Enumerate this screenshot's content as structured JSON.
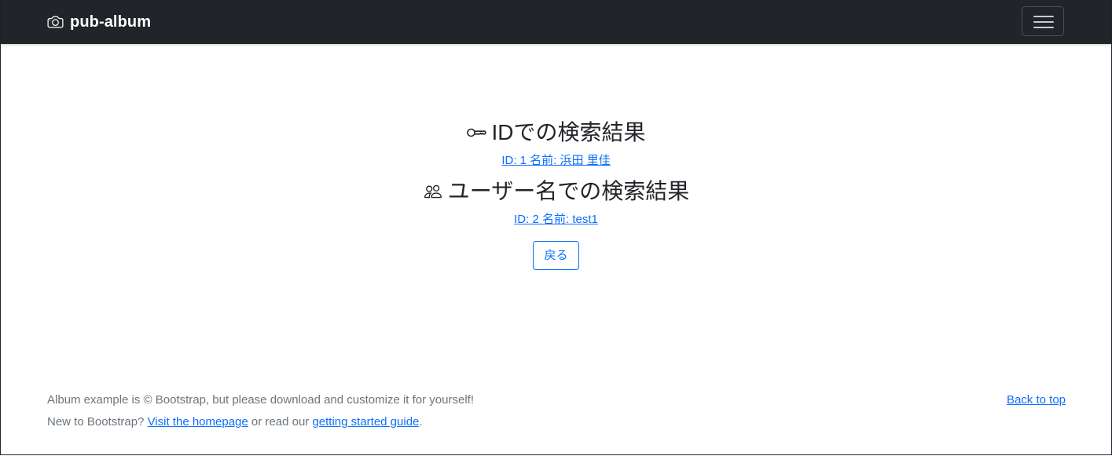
{
  "navbar": {
    "brand": "pub-album",
    "brand_icon": "camera-icon",
    "toggler_icon": "hamburger-icon"
  },
  "results": {
    "id_heading": "IDでの検索結果",
    "id_heading_icon": "key-icon",
    "id_result": "ID: 1 名前: 浜田 里佳",
    "name_heading": "ユーザー名での検索結果",
    "name_heading_icon": "people-icon",
    "name_result": "ID: 2 名前: test1",
    "back_label": "戻る"
  },
  "footer": {
    "line1": "Album example is © Bootstrap, but please download and customize it for yourself!",
    "line2_prefix": "New to Bootstrap?",
    "homepage_link": "Visit the homepage",
    "line2_middle": "or read our",
    "guide_link": "getting started guide",
    "line2_suffix": ".",
    "back_to_top": "Back to top"
  },
  "colors": {
    "navbar_bg": "#212529",
    "link": "#0d6efd",
    "muted": "#6c757d"
  }
}
